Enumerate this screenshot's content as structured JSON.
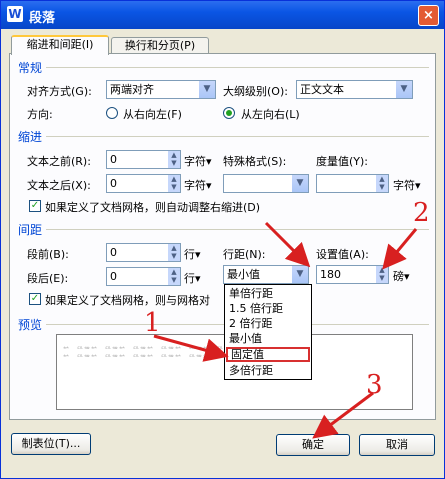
{
  "window": {
    "title": "段落",
    "close": "×"
  },
  "tabs": [
    {
      "label": "缩进和间距(I)"
    },
    {
      "label": "换行和分页(P)"
    }
  ],
  "general": {
    "section": "常规",
    "align_label": "对齐方式(G):",
    "align_value": "两端对齐",
    "outline_label": "大纲级别(O):",
    "outline_value": "正文文本",
    "direction_label": "方向:",
    "rtl_label": "从右向左(F)",
    "ltr_label": "从左向右(L)"
  },
  "indent": {
    "section": "缩进",
    "before_label": "文本之前(R):",
    "before_value": "0",
    "before_unit": "字符▾",
    "after_label": "文本之后(X):",
    "after_value": "0",
    "after_unit": "字符▾",
    "special_label": "特殊格式(S):",
    "measure_label": "度量值(Y):",
    "measure_unit": "字符▾",
    "grid_check": "如果定义了文档网格，则自动调整右缩进(D)"
  },
  "spacing": {
    "section": "间距",
    "before_label": "段前(B):",
    "before_value": "0",
    "before_unit": "行▾",
    "after_label": "段后(E):",
    "after_value": "0",
    "after_unit": "行▾",
    "line_label": "行距(N):",
    "line_value": "最小值",
    "set_label": "设置值(A):",
    "set_value": "180",
    "set_unit": "磅▾",
    "grid_check": "如果定义了文档网格，则与网格对"
  },
  "line_options": [
    "单倍行距",
    "1.5 倍行距",
    "2 倍行距",
    "最小值",
    "固定值",
    "多倍行距"
  ],
  "preview": {
    "section": "预览",
    "sample": "前一段落前一段落前一段落前一段落前一段落前一段落前一段落前一段落"
  },
  "buttons": {
    "tabs": "制表位(T)...",
    "ok": "确定",
    "cancel": "取消"
  },
  "annotations": [
    "1",
    "2",
    "3"
  ],
  "colors": {
    "titlebar": "#0a55e4",
    "annotation": "#d82020",
    "selection_box": "#d83030"
  }
}
